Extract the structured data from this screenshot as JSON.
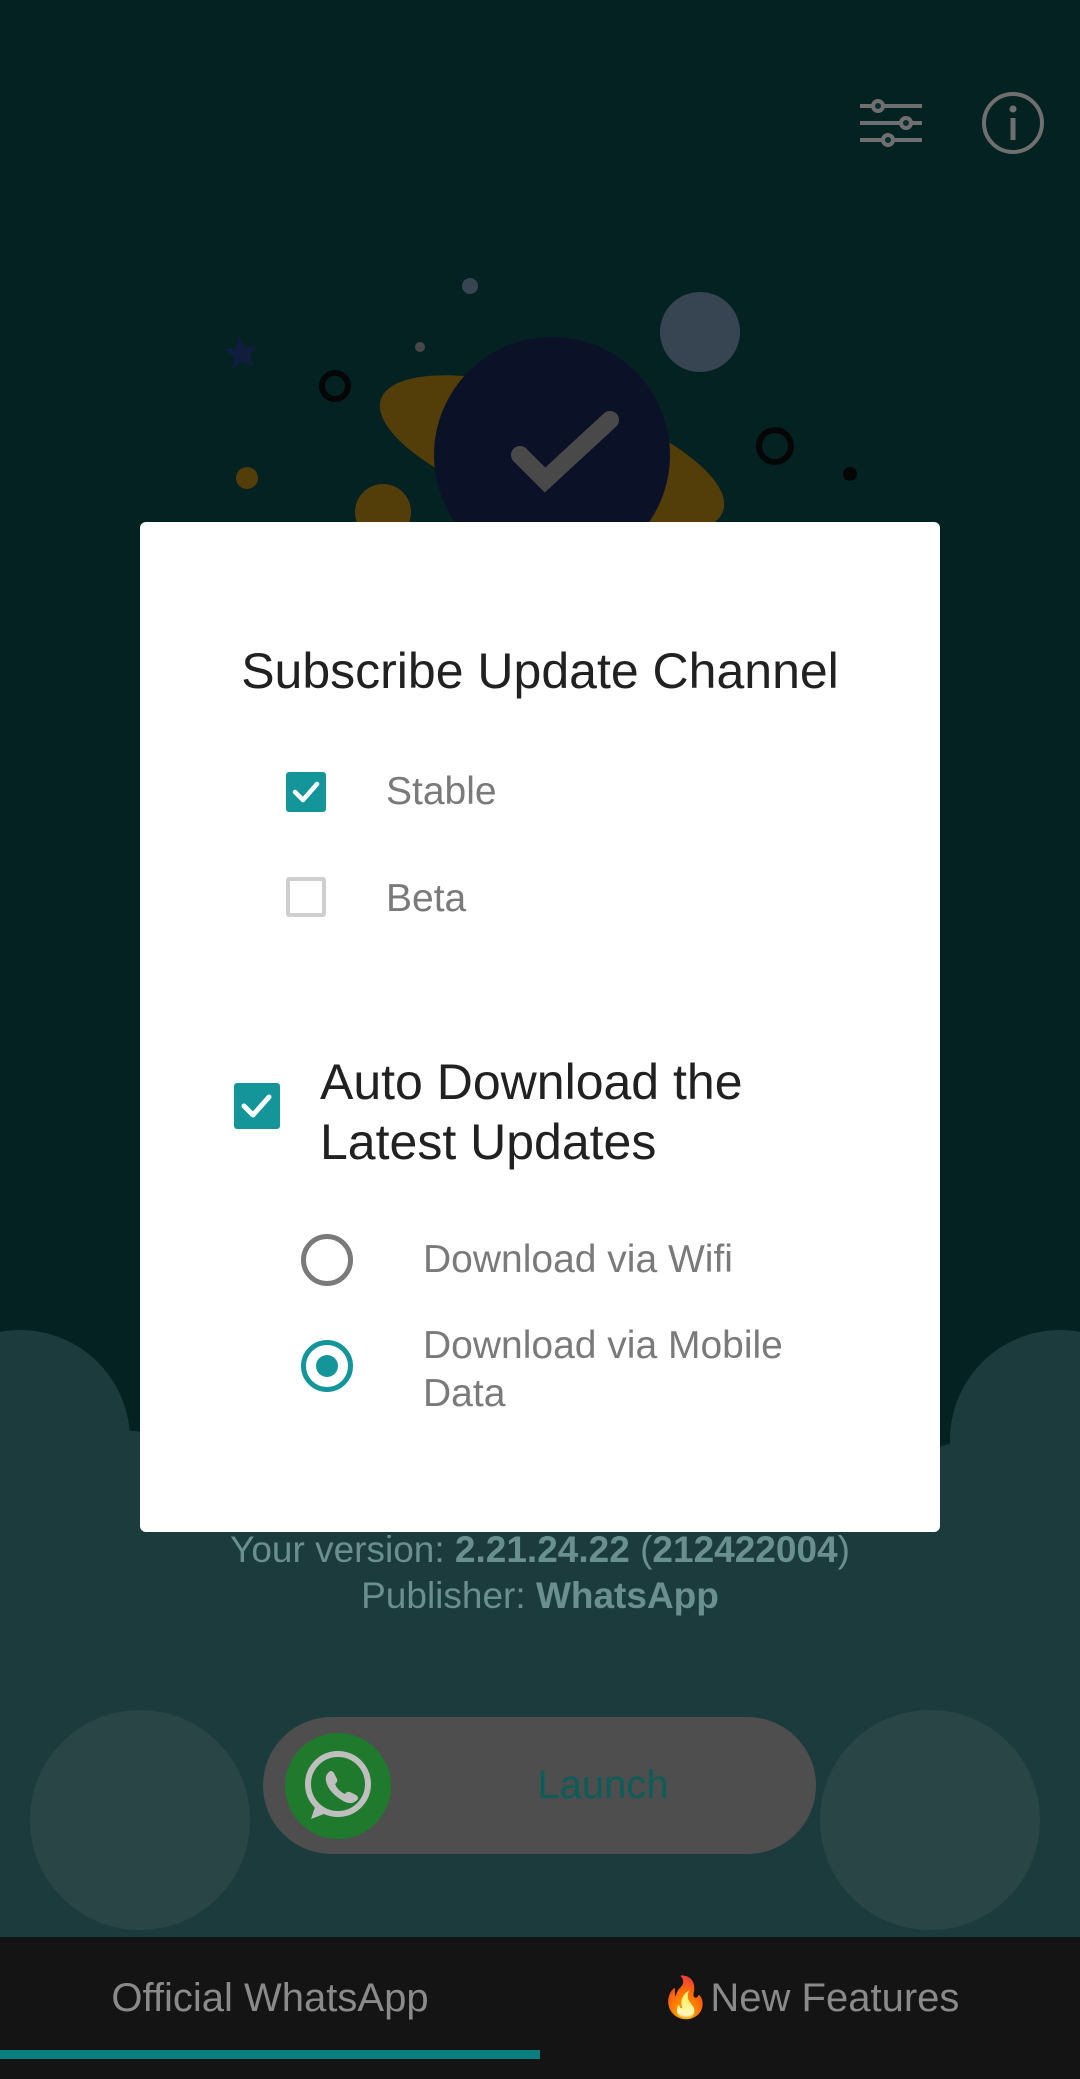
{
  "dialog": {
    "title": "Subscribe Update Channel",
    "channels": [
      {
        "label": "Stable",
        "checked": true
      },
      {
        "label": "Beta",
        "checked": false
      }
    ],
    "auto_download": {
      "label": "Auto Download the Latest Updates",
      "checked": true
    },
    "download_options": [
      {
        "label": "Download via Wifi",
        "selected": false
      },
      {
        "label": "Download via Mobile Data",
        "selected": true
      }
    ]
  },
  "version_info": {
    "version_prefix": "Your version: ",
    "version": "2.21.24.22",
    "build_open": " (",
    "build": "212422004",
    "build_close": ")",
    "publisher_prefix": "Publisher: ",
    "publisher": "WhatsApp"
  },
  "launch_button": {
    "label": "Launch",
    "icon": "whatsapp-icon"
  },
  "tabs": [
    {
      "label": "Official WhatsApp",
      "active": true
    },
    {
      "label": "🔥New Features",
      "active": false
    }
  ],
  "header_icons": [
    "filter-sliders-icon",
    "info-icon"
  ],
  "colors": {
    "accent": "#14959a",
    "background": "#0a4a4a",
    "tab_indicator": "#0b7f80",
    "dialog": "#ffffff"
  }
}
